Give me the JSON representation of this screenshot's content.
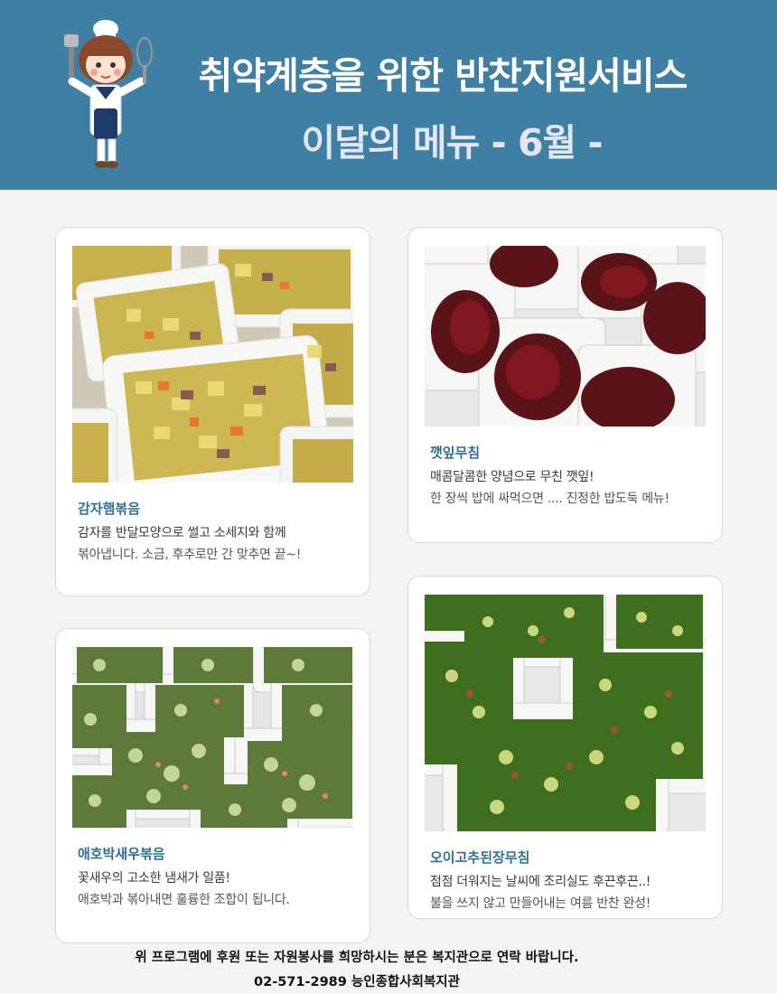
{
  "header": {
    "title": "취약계층을 위한 반찬지원서비스",
    "subtitle": "이달의 메뉴 - 6월 -"
  },
  "menu": [
    {
      "name": "감자햄볶음",
      "desc_line1": "감자를 반달모양으로 썰고 소세지와 함께",
      "desc_line2": "볶아냅니다. 소금, 후추로만 간 맞추면 끝~!"
    },
    {
      "name": "깻잎무침",
      "desc_line1": "매콤달콤한 양념으로 무친 깻잎!",
      "desc_line2": "한 장씩 밥에 싸먹으면 .... 진정한 밥도둑 메뉴!"
    },
    {
      "name": "애호박새우볶음",
      "desc_line1": "꽃새우의 고소한 냄새가 일품!",
      "desc_line2": "애호박과 볶아내면 훌륭한 조합이 됩니다."
    },
    {
      "name": "오이고추된장무침",
      "desc_line1": "점점 더워지는 날씨에 조리실도 후끈후끈..!",
      "desc_line2": "불을 쓰지 않고 만들어내는 여름 반찬 완성!"
    }
  ],
  "footer": {
    "line1": "위 프로그램에 후원 또는 자원봉사를 희망하시는 분은 복지관으로 연락 바랍니다.",
    "line2": "02-571-2989 능인종합사회복지관"
  },
  "colors": {
    "header_bg": "#3f7fa3",
    "dish_title": "#2f6f96"
  }
}
